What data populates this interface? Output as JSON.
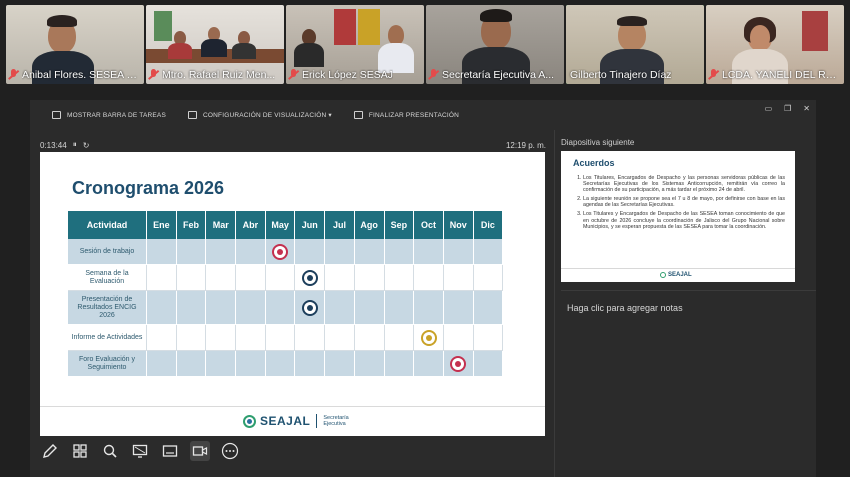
{
  "participants": [
    {
      "name": "Anibal Flores. SESEA S...",
      "muted": true,
      "active": false
    },
    {
      "name": "Mtro. Rafael Ruiz Men...",
      "muted": true,
      "active": false
    },
    {
      "name": "Erick López SESAJ",
      "muted": true,
      "active": false
    },
    {
      "name": "Secretaría Ejecutiva A...",
      "muted": true,
      "active": false
    },
    {
      "name": "Gilberto Tinajero Díaz",
      "muted": false,
      "active": true
    },
    {
      "name": "LCDA. YANELI DEL RAZ...",
      "muted": true,
      "active": false
    }
  ],
  "toolbar": {
    "taskbar_label": "MOSTRAR BARRA DE TAREAS",
    "display_settings_label": "CONFIGURACIÓN DE VISUALIZACIÓN ▾",
    "end_show_label": "FINALIZAR PRESENTACIÓN"
  },
  "window_controls": {
    "minimize": "▭",
    "restore": "❐",
    "close": "✕"
  },
  "timer": {
    "elapsed": "0:13:44",
    "pause": "⏸",
    "reset": "↻",
    "clock": "12:19 p. m."
  },
  "slide": {
    "title": "Cronograma 2026",
    "header_activity": "Actividad",
    "months": [
      "Ene",
      "Feb",
      "Mar",
      "Abr",
      "May",
      "Jun",
      "Jul",
      "Ago",
      "Sep",
      "Oct",
      "Nov",
      "Dic"
    ],
    "rows": [
      {
        "activity": "Sesión de trabajo",
        "month_index": 4,
        "color": "red",
        "shaded": true
      },
      {
        "activity": "Semana de la Evaluación",
        "month_index": 5,
        "color": "navy",
        "shaded": false
      },
      {
        "activity": "Presentación de Resultados ENCIG 2026",
        "month_index": 5,
        "color": "navy",
        "shaded": true
      },
      {
        "activity": "Informe de Actividades",
        "month_index": 9,
        "color": "gold",
        "shaded": false
      },
      {
        "activity": "Foro Evaluación y Seguimiento",
        "month_index": 10,
        "color": "red",
        "shaded": true
      }
    ],
    "brand": "SEAJAL",
    "brand_sub_1": "Secretaría",
    "brand_sub_2": "Ejecutiva"
  },
  "next_slide": {
    "label": "Diapositiva siguiente",
    "title": "Acuerdos",
    "items": [
      "Los Titulares, Encargados de Despacho y las personas servidoras públicas de las Secretarías Ejecutivas de los Sistemas Anticorrupción, remitirán vía correo la confirmación de su participación, a más tardar el próximo 24 de abril.",
      "La siguiente reunión se propone sea el 7 u 8 de mayo, por definirse con base en las agendas de las Secretarías Ejecutivas.",
      "Los Titulares y Encargados de Despacho de las SESEA toman conocimiento de que en octubre de 2026 concluye la coordinación de Jalisco del Grupo Nacional sobre Municipios, y se esperan propuesta de las SESEA para tomar la coordinación."
    ],
    "brand": "SEAJAL"
  },
  "notes": {
    "placeholder": "Haga clic para agregar notas"
  },
  "bottom_tools": [
    "pen-icon",
    "grid-icon",
    "zoom-icon",
    "screen-icon",
    "subtitles-icon",
    "camera-icon",
    "more-icon"
  ],
  "colors": {
    "header": "#1f6f7e",
    "shaded_row": "#c7d8e3",
    "active_tile": "#3ccf6b",
    "red": "#c4304f",
    "navy": "#1d3f5c",
    "gold": "#c9a227"
  }
}
